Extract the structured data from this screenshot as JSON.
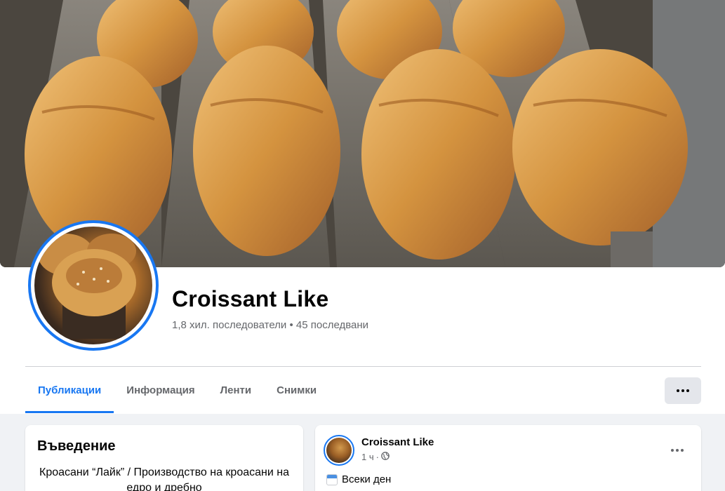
{
  "page": {
    "name": "Croissant Like",
    "stats": "1,8 хил. последователи • 45 последвани"
  },
  "tabs": [
    {
      "label": "Публикации",
      "active": true
    },
    {
      "label": "Информация",
      "active": false
    },
    {
      "label": "Ленти",
      "active": false
    },
    {
      "label": "Снимки",
      "active": false
    }
  ],
  "intro": {
    "title": "Въведение",
    "bio": "Кроасани “Лайк” / Производство на кроасани на едро и дребно"
  },
  "post": {
    "author": "Croissant Like",
    "time": "1 ч",
    "separator": "·",
    "text": "Всеки ден"
  },
  "colors": {
    "accent": "#1877f2",
    "secondary_text": "#65676b",
    "background": "#f0f2f5"
  },
  "icons": {
    "more": "three-dots-icon",
    "audience": "globe-icon",
    "calendar": "calendar-emoji-icon"
  }
}
